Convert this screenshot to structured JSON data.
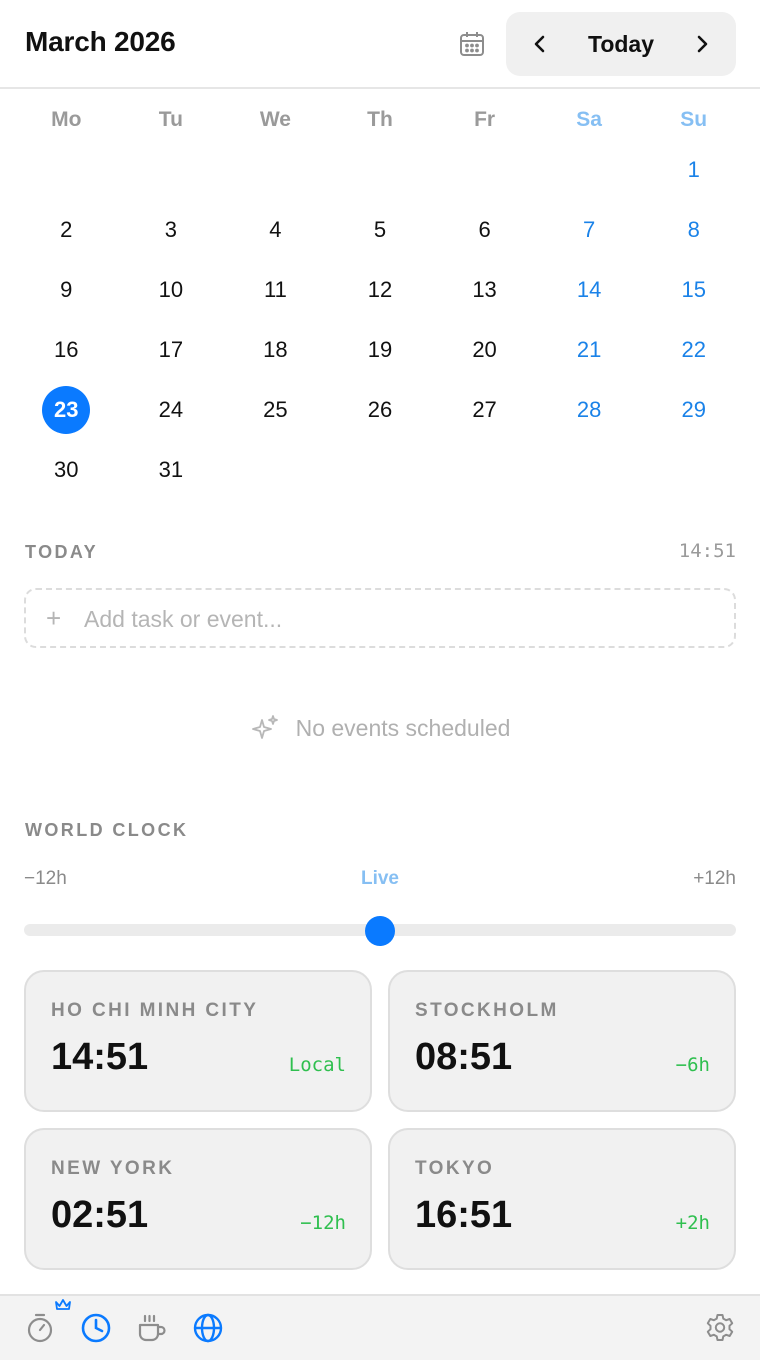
{
  "header": {
    "month_title": "March 2026",
    "today_label": "Today"
  },
  "calendar": {
    "weekdays": [
      "Mo",
      "Tu",
      "We",
      "Th",
      "Fr",
      "Sa",
      "Su"
    ],
    "days": [
      "",
      "",
      "",
      "",
      "",
      "",
      "1",
      "2",
      "3",
      "4",
      "5",
      "6",
      "7",
      "8",
      "9",
      "10",
      "11",
      "12",
      "13",
      "14",
      "15",
      "16",
      "17",
      "18",
      "19",
      "20",
      "21",
      "22",
      "23",
      "24",
      "25",
      "26",
      "27",
      "28",
      "29",
      "30",
      "31",
      "",
      "",
      "",
      "",
      ""
    ],
    "selected_day": "23"
  },
  "today": {
    "label": "TODAY",
    "time": "14:51",
    "add_placeholder": "Add task or event...",
    "add_plus": "+",
    "empty_text": "No events scheduled"
  },
  "world_clock": {
    "label": "WORLD CLOCK",
    "slider_min": "−12h",
    "slider_center": "Live",
    "slider_max": "+12h",
    "slider_value": 0.5,
    "clocks": [
      {
        "city": "HO CHI MINH CITY",
        "time": "14:51",
        "offset": "Local"
      },
      {
        "city": "STOCKHOLM",
        "time": "08:51",
        "offset": "−6h"
      },
      {
        "city": "NEW YORK",
        "time": "02:51",
        "offset": "−12h"
      },
      {
        "city": "TOKYO",
        "time": "16:51",
        "offset": "+2h"
      }
    ]
  },
  "footer": {
    "icons": [
      "stopwatch-icon",
      "clock-icon",
      "coffee-icon",
      "globe-icon",
      "gear-icon"
    ],
    "crown_icon": "crown-icon"
  },
  "colors": {
    "accent": "#0a7aff",
    "weekend": "#1a82e8",
    "weekend_header": "#86bff3",
    "offset_green": "#2fbf4f"
  }
}
